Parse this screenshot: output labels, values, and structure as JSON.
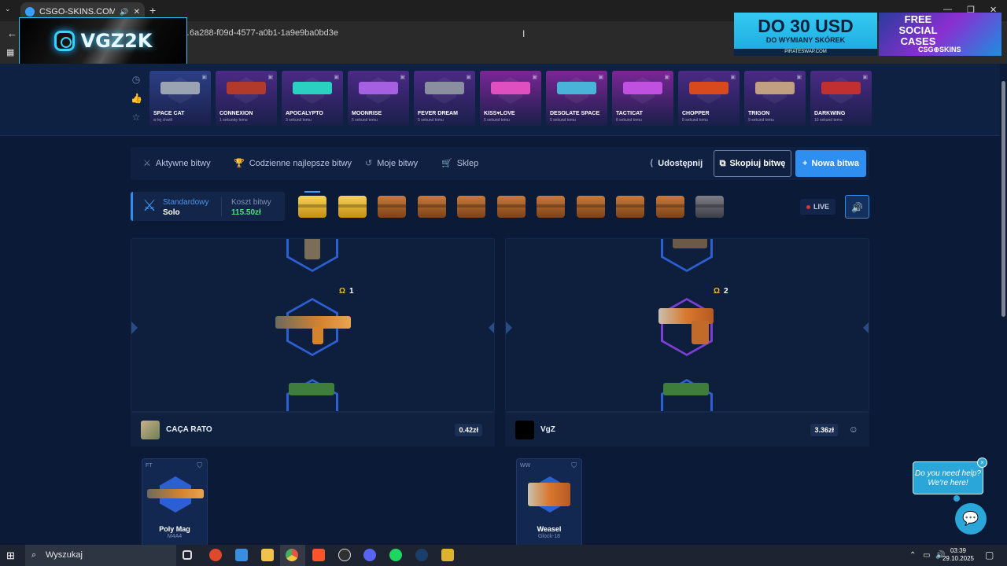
{
  "browser": {
    "tab_title": "CSGO-SKINS.COM - Najlep",
    "url": "…6a288-f09d-4577-a0b1-1a9e9ba0bd3e"
  },
  "overlay": {
    "logo_text": "VGZ2K",
    "ad1_big": "DO 30 USD",
    "ad1_small": "DO WYMIANY SKÓREK",
    "ad1_foot": "PIRATESWAP.COM",
    "ad2_title": "FREE SOCIAL CASES",
    "ad2_brand": "CSG⊕SKINS"
  },
  "live_drops": [
    {
      "name": "SPACE CAT",
      "time": "w tej chwili",
      "color": "#2c3f86",
      "gun": "#9aa3b2"
    },
    {
      "name": "CONNEXION",
      "time": "1 sekundę temu",
      "color": "#4b2a86",
      "gun": "#b23a2a"
    },
    {
      "name": "APOCALYPTO",
      "time": "3 sekund temu",
      "color": "#4b2a86",
      "gun": "#2ad0c0"
    },
    {
      "name": "MOONRISE",
      "time": "5 sekund temu",
      "color": "#4b2a86",
      "gun": "#a460e0"
    },
    {
      "name": "FEVER DREAM",
      "time": "5 sekund temu",
      "color": "#4b2a86",
      "gun": "#8a8fa0"
    },
    {
      "name": "KISS♥LOVE",
      "time": "5 sekund temu",
      "color": "#7a2696",
      "gun": "#e04fbf"
    },
    {
      "name": "DESOLATE SPACE",
      "time": "5 sekund temu",
      "color": "#7a2696",
      "gun": "#4ab3d8"
    },
    {
      "name": "TACTICAT",
      "time": "8 sekund temu",
      "color": "#7a2696",
      "gun": "#c050e0"
    },
    {
      "name": "CHOPPER",
      "time": "8 sekund temu",
      "color": "#4b2a86",
      "gun": "#d84a1e"
    },
    {
      "name": "TRIGON",
      "time": "9 sekund temu",
      "color": "#4b2a86",
      "gun": "#c0a080"
    },
    {
      "name": "DARKWING",
      "time": "10 sekund temu",
      "color": "#4b2a86",
      "gun": "#c03030"
    }
  ],
  "nav": {
    "active_battles": "Aktywne bitwy",
    "daily_best": "Codzienne najlepsze bitwy",
    "my_battles": "Moje bitwy",
    "shop": "Sklep",
    "share": "Udostępnij",
    "copy_battle": "Skopiuj bitwę",
    "new_battle": "Nowa bitwa"
  },
  "battle": {
    "mode_label": "Standardowy",
    "mode_value": "Solo",
    "cost_label": "Koszt bitwy",
    "cost_value": "115.50zł",
    "live_label": "LIVE",
    "cases": [
      "gold",
      "gold",
      "wood",
      "wood",
      "wood",
      "wood",
      "wood",
      "wood",
      "wood",
      "wood",
      "gray"
    ]
  },
  "players": [
    {
      "name": "CAÇA RATO",
      "value": "0.42zł",
      "round": "1",
      "loot_cond": "FT",
      "loot_name": "Poly Mag",
      "loot_type": "M4A4"
    },
    {
      "name": "VgZ",
      "value": "3.36zł",
      "round": "2",
      "loot_cond": "WW",
      "loot_name": "Weasel",
      "loot_type": "Glock-18"
    }
  ],
  "chat": {
    "bubble": "Do you need help? We're here!"
  },
  "taskbar": {
    "search": "Wyszukaj",
    "time": "03:39",
    "date": "29.10.2025"
  },
  "colors": {
    "accent": "#2f8ff1",
    "background": "#0b1a36",
    "coin": "#f1b928"
  }
}
